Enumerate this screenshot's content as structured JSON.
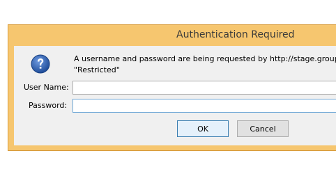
{
  "dialog": {
    "title": "Authentication Required",
    "message_line1": "A username and password are being requested by http://stage.groupbu",
    "message_line2": "\"Restricted\"",
    "question_icon": "question-icon",
    "username_label": "User Name:",
    "username_value": "",
    "password_label": "Password:",
    "password_value": "",
    "ok_label": "OK",
    "cancel_label": "Cancel"
  },
  "colors": {
    "frame": "#f6c66f",
    "client": "#f0f0f0",
    "icon_blue": "#2e5fae"
  }
}
